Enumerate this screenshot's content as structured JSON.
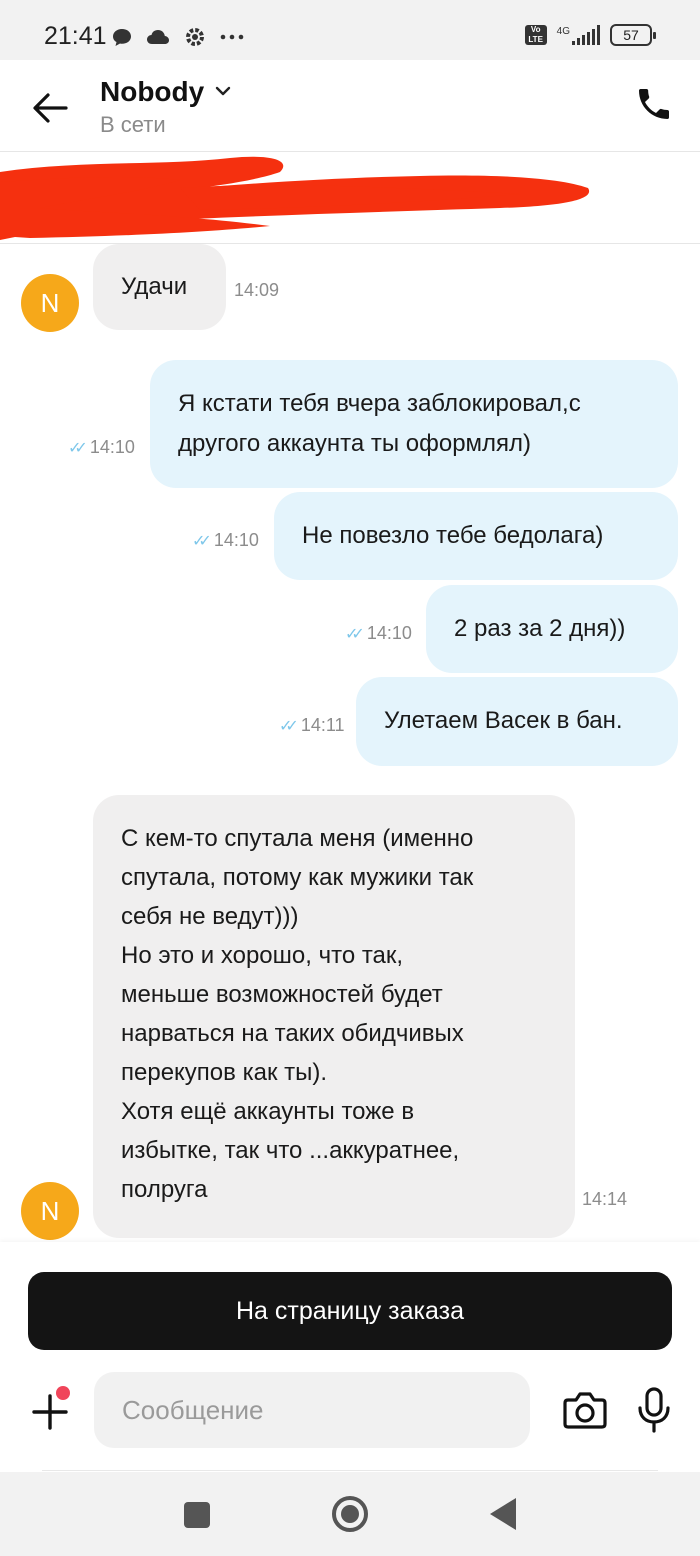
{
  "status_bar": {
    "time": "21:41",
    "network": "4G",
    "volte": "Vo LTE",
    "battery": "57"
  },
  "header": {
    "contact_name": "Nobody",
    "status": "В сети"
  },
  "messages": [
    {
      "direction": "in",
      "text": "Удачи",
      "time": "14:09"
    },
    {
      "direction": "out",
      "lines": [
        "Я кстати тебя вчера заблокировал,с",
        "другого аккаунта ты оформлял)"
      ],
      "time": "14:10"
    },
    {
      "direction": "out",
      "text": "Не повезло тебе бедолага)",
      "time": "14:10"
    },
    {
      "direction": "out",
      "text": "2 раз за 2 дня))",
      "time": "14:10"
    },
    {
      "direction": "out",
      "text": "Улетаем Васек в бан.",
      "time": "14:11"
    },
    {
      "direction": "in",
      "lines": [
        "С кем-то спутала меня (именно",
        "спутала, потому как мужики так",
        "себя не ведут)))",
        "Но это и хорошо, что так,",
        "меньше возможностей будет",
        "нарваться на таких обидчивых",
        "перекупов как ты).",
        "Хотя ещё аккаунты тоже в",
        "избытке, так что ...аккуратнее,",
        "полруга"
      ],
      "time": "14:14"
    }
  ],
  "avatar_letter": "N",
  "composer": {
    "order_button": "На страницу заказа",
    "placeholder": "Сообщение"
  },
  "colors": {
    "incoming_bubble": "#f0efef",
    "outgoing_bubble": "#e4f4fc",
    "avatar": "#f6a81a",
    "read_ticks": "#7ec7ea",
    "redaction": "#f5300f"
  }
}
